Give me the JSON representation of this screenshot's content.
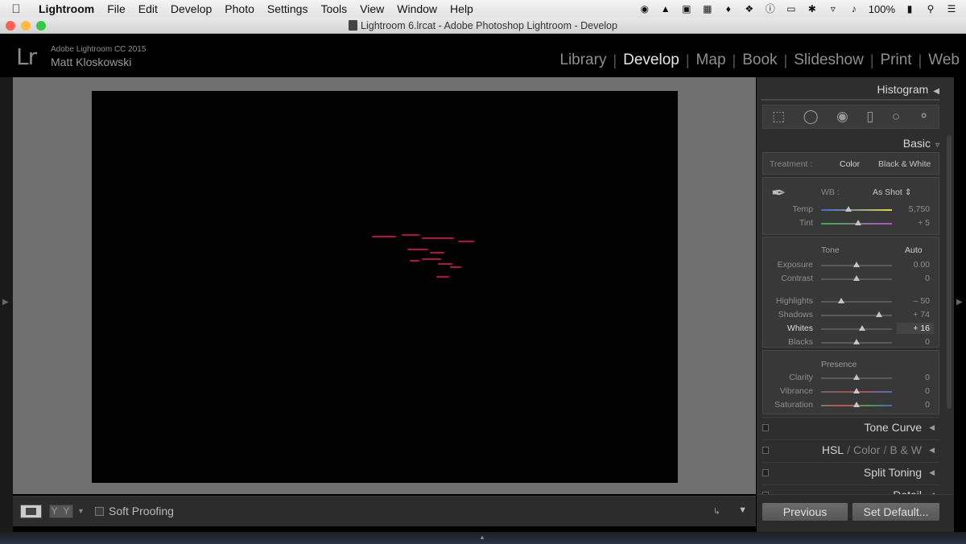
{
  "menubar": {
    "app_name": "Lightroom",
    "items": [
      "File",
      "Edit",
      "Develop",
      "Photo",
      "Settings",
      "Tools",
      "View",
      "Window",
      "Help"
    ],
    "battery": "100%"
  },
  "window": {
    "title": "Lightroom 6.lrcat - Adobe Photoshop Lightroom - Develop"
  },
  "identity": {
    "logo": "Lr",
    "product": "Adobe Lightroom CC 2015",
    "user": "Matt Kloskowski"
  },
  "modules": [
    "Library",
    "Develop",
    "Map",
    "Book",
    "Slideshow",
    "Print",
    "Web"
  ],
  "active_module": "Develop",
  "toolbar": {
    "soft_proofing": "Soft Proofing",
    "compare_label": "Y Y"
  },
  "panel": {
    "histogram": "Histogram",
    "basic": "Basic",
    "treatment_label": "Treatment :",
    "treatment_color": "Color",
    "treatment_bw": "Black & White",
    "wb_label": "WB :",
    "wb_value": "As Shot",
    "tone_label": "Tone",
    "auto_label": "Auto",
    "presence_label": "Presence",
    "sliders": {
      "temp": {
        "name": "Temp",
        "value": "5,750",
        "pos": 0.39
      },
      "tint": {
        "name": "Tint",
        "value": "+ 5",
        "pos": 0.52
      },
      "exposure": {
        "name": "Exposure",
        "value": "0.00",
        "pos": 0.5
      },
      "contrast": {
        "name": "Contrast",
        "value": "0",
        "pos": 0.5
      },
      "highlights": {
        "name": "Highlights",
        "value": "– 50",
        "pos": 0.28
      },
      "shadows": {
        "name": "Shadows",
        "value": "+ 74",
        "pos": 0.82
      },
      "whites": {
        "name": "Whites",
        "value": "+ 16",
        "pos": 0.58
      },
      "blacks": {
        "name": "Blacks",
        "value": "0",
        "pos": 0.5
      },
      "clarity": {
        "name": "Clarity",
        "value": "0",
        "pos": 0.5
      },
      "vibrance": {
        "name": "Vibrance",
        "value": "0",
        "pos": 0.5
      },
      "saturation": {
        "name": "Saturation",
        "value": "0",
        "pos": 0.5
      }
    },
    "tone_curve": "Tone Curve",
    "hsl": "HSL",
    "hsl_color": "Color",
    "hsl_bw": "B & W",
    "split_toning": "Split Toning",
    "detail": "Detail",
    "previous": "Previous",
    "set_default": "Set Default..."
  },
  "colors": {
    "clipping_highlight": "#b0124a",
    "active_module": "#e6e6e6"
  }
}
